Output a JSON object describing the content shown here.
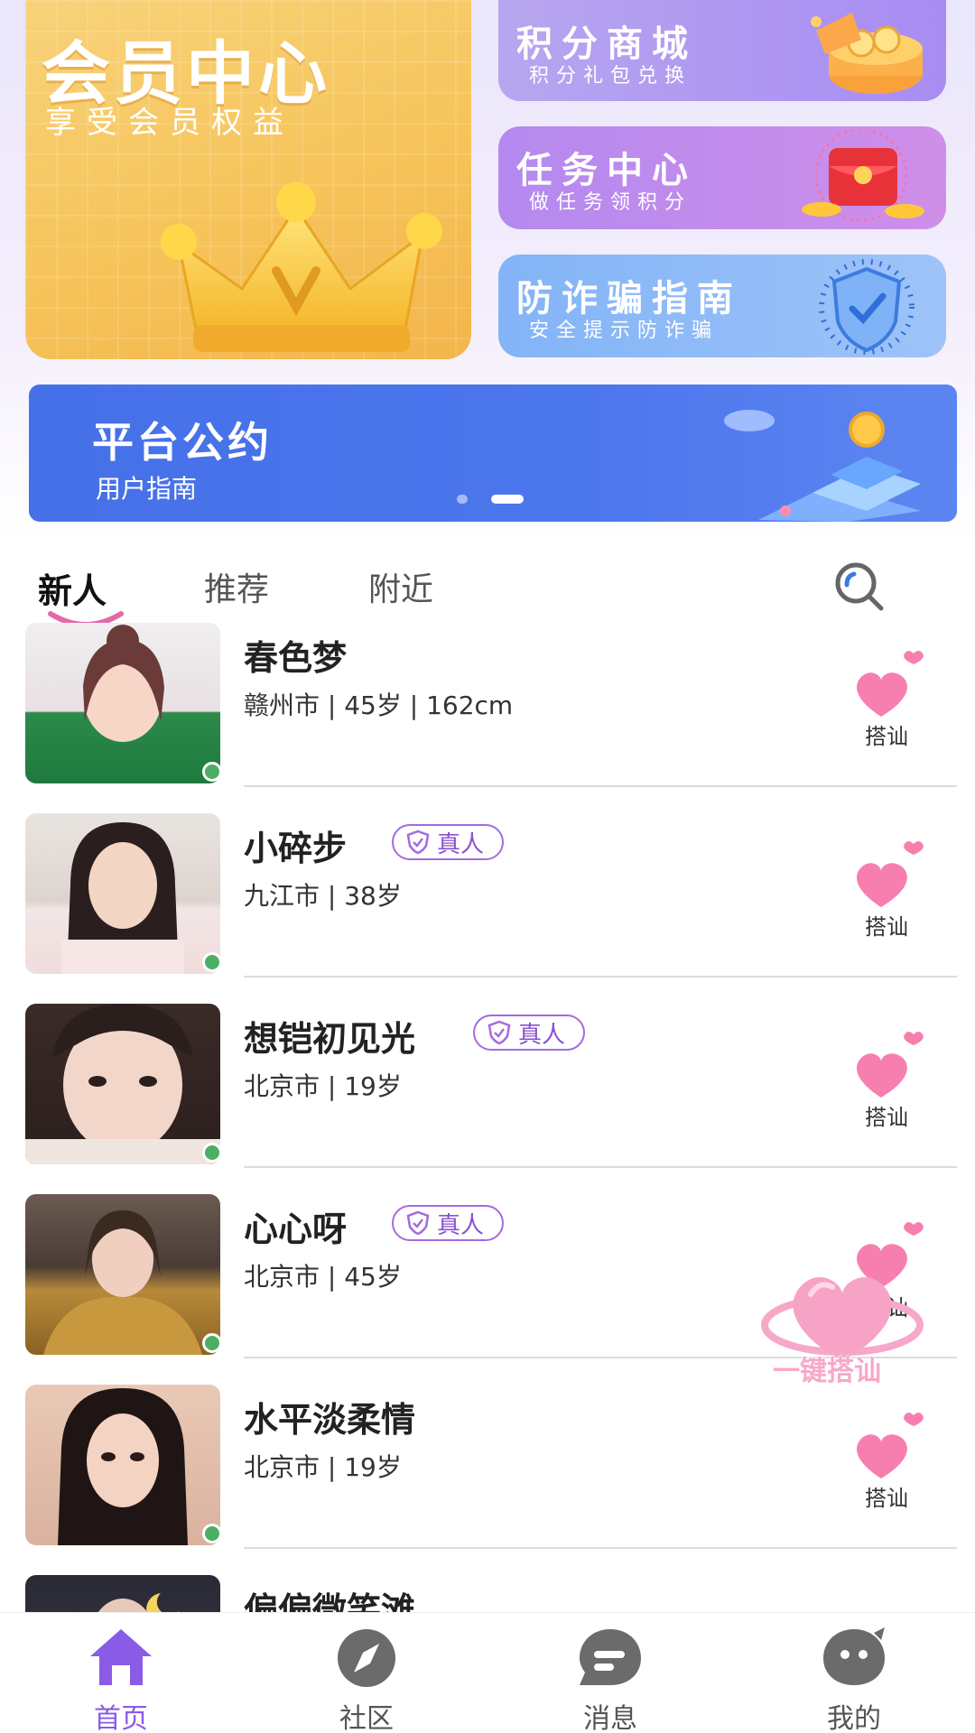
{
  "header": {
    "member": {
      "title": "会员中心",
      "subtitle": "享受会员权益"
    },
    "cards": [
      {
        "title": "积分商城",
        "subtitle": "积分礼包兑换"
      },
      {
        "title": "任务中心",
        "subtitle": "做任务领积分"
      },
      {
        "title": "防诈骗指南",
        "subtitle": "安全提示防诈骗"
      }
    ],
    "banner": {
      "title": "平台公约",
      "subtitle": "用户指南"
    }
  },
  "tabs": [
    {
      "label": "新人",
      "active": true
    },
    {
      "label": "推荐",
      "active": false
    },
    {
      "label": "附近",
      "active": false
    }
  ],
  "users": [
    {
      "name": "春色梦",
      "meta": "赣州市 | 45岁 | 162cm",
      "verified": false,
      "action": "搭讪"
    },
    {
      "name": "小碎步",
      "meta": "九江市 | 38岁",
      "verified": true,
      "badge": "真人",
      "action": "搭讪"
    },
    {
      "name": "想铠初见光",
      "meta": "北京市 | 19岁",
      "verified": true,
      "badge": "真人",
      "action": "搭讪"
    },
    {
      "name": "心心呀",
      "meta": "北京市 | 45岁",
      "verified": true,
      "badge": "真人",
      "action": "搭讪"
    },
    {
      "name": "水平淡柔情",
      "meta": "北京市 | 19岁",
      "verified": false,
      "action": "搭讪"
    },
    {
      "name": "偏偏微笑滩",
      "meta": "",
      "verified": false,
      "action": ""
    }
  ],
  "floating": {
    "label": "一键搭讪"
  },
  "nav": [
    {
      "label": "首页",
      "icon": "home-icon",
      "active": true
    },
    {
      "label": "社区",
      "icon": "compass-icon",
      "active": false
    },
    {
      "label": "消息",
      "icon": "message-icon",
      "active": false
    },
    {
      "label": "我的",
      "icon": "profile-icon",
      "active": false
    }
  ],
  "colors": {
    "accent": "#8a5be6",
    "online": "#4cae62",
    "heart": "#f77fb0"
  }
}
